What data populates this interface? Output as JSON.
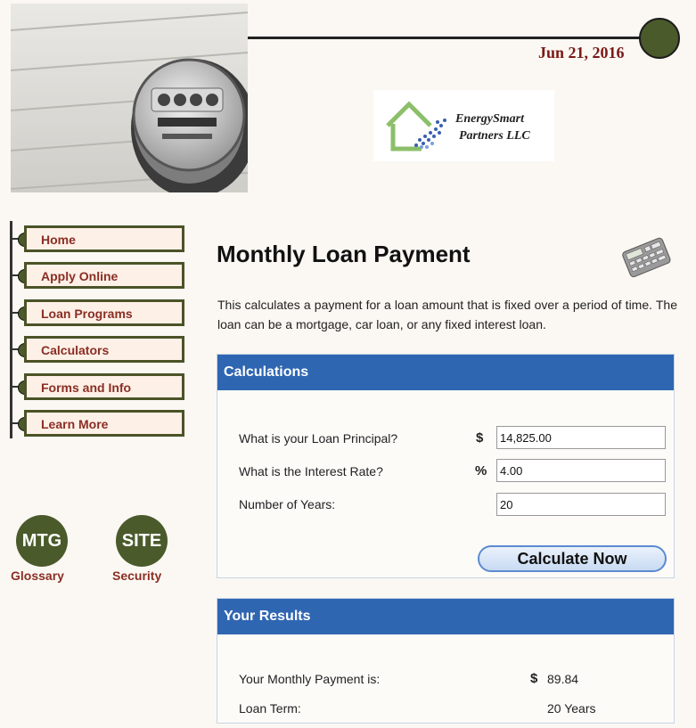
{
  "header": {
    "date": "Jun 21, 2016"
  },
  "logo": {
    "line1": "EnergySmart",
    "line2": "Partners LLC"
  },
  "nav": {
    "items": [
      "Home",
      "Apply Online",
      "Loan Programs",
      "Calculators",
      "Forms and Info",
      "Learn More"
    ]
  },
  "badges": [
    {
      "text": "MTG",
      "caption": "Glossary"
    },
    {
      "text": "SITE",
      "caption": "Security"
    }
  ],
  "page": {
    "title": "Monthly Loan Payment",
    "intro": "This calculates a payment for a loan amount that is fixed over a period of time.  The loan can be a mortgage, car loan, or any fixed interest loan."
  },
  "calc": {
    "heading": "Calculations",
    "principal_label": "What is your Loan Principal?",
    "principal_symbol": "$",
    "principal_value": "14,825.00",
    "rate_label": "What is the Interest Rate?",
    "rate_symbol": "%",
    "rate_value": "4.00",
    "years_label": "Number of Years:",
    "years_value": "20",
    "button_label": "Calculate Now"
  },
  "results": {
    "heading": "Your Results",
    "payment_label": "Your Monthly Payment is:",
    "payment_symbol": "$",
    "payment_value": "89.84",
    "term_label": "Loan Term:",
    "term_value": "20 Years"
  }
}
